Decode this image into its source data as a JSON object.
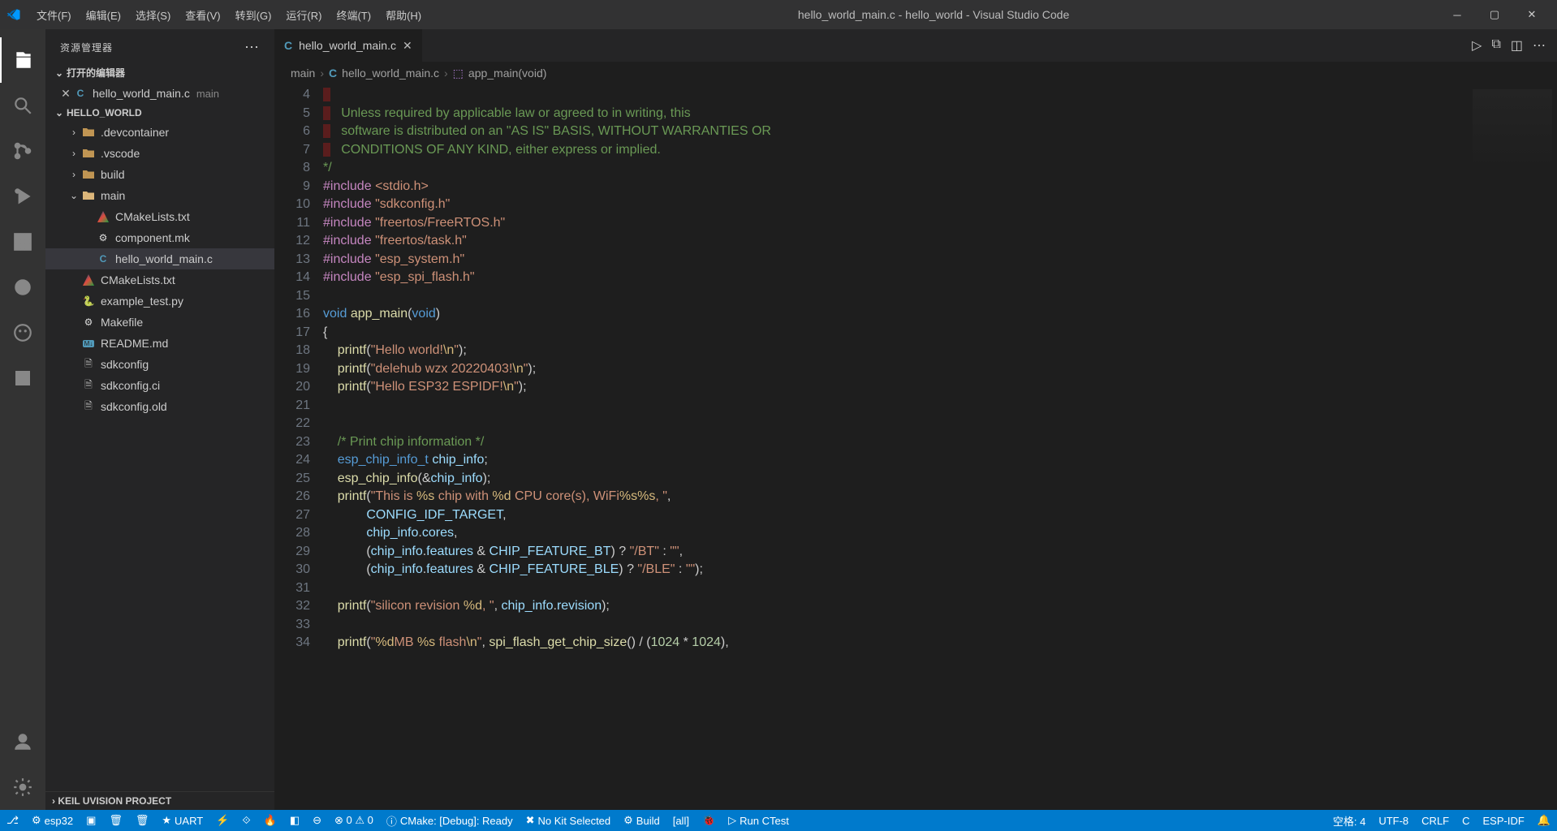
{
  "window": {
    "title": "hello_world_main.c - hello_world - Visual Studio Code",
    "menu": [
      "文件(F)",
      "编辑(E)",
      "选择(S)",
      "查看(V)",
      "转到(G)",
      "运行(R)",
      "终端(T)",
      "帮助(H)"
    ]
  },
  "sidebar": {
    "header": "资源管理器",
    "open_editors_label": "打开的编辑器",
    "open_editor_file": "hello_world_main.c",
    "open_editor_folder": "main",
    "project_label": "HELLO_WORLD",
    "bottom_panel": "KEIL UVISION PROJECT",
    "tree": [
      {
        "type": "folder",
        "label": ".devcontainer",
        "depth": 1
      },
      {
        "type": "folder",
        "label": ".vscode",
        "depth": 1
      },
      {
        "type": "folder",
        "label": "build",
        "depth": 1
      },
      {
        "type": "folder",
        "label": "main",
        "depth": 1,
        "open": true
      },
      {
        "type": "cmake",
        "label": "CMakeLists.txt",
        "depth": 2
      },
      {
        "type": "gear",
        "label": "component.mk",
        "depth": 2
      },
      {
        "type": "c",
        "label": "hello_world_main.c",
        "depth": 2,
        "selected": true
      },
      {
        "type": "cmake",
        "label": "CMakeLists.txt",
        "depth": 1
      },
      {
        "type": "py",
        "label": "example_test.py",
        "depth": 1
      },
      {
        "type": "gear",
        "label": "Makefile",
        "depth": 1
      },
      {
        "type": "md",
        "label": "README.md",
        "depth": 1
      },
      {
        "type": "file",
        "label": "sdkconfig",
        "depth": 1
      },
      {
        "type": "file",
        "label": "sdkconfig.ci",
        "depth": 1
      },
      {
        "type": "file",
        "label": "sdkconfig.old",
        "depth": 1
      }
    ]
  },
  "tab": {
    "label": "hello_world_main.c"
  },
  "breadcrumbs": {
    "root": "main",
    "file": "hello_world_main.c",
    "symbol": "app_main(void)"
  },
  "code_lines": [
    {
      "n": 4,
      "html": "",
      "red": true
    },
    {
      "n": 5,
      "html": "   Unless required by applicable law or agreed to in writing, this",
      "cmt": true,
      "red": true
    },
    {
      "n": 6,
      "html": "   software is distributed on an \"AS IS\" BASIS, WITHOUT WARRANTIES OR",
      "cmt": true,
      "red": true
    },
    {
      "n": 7,
      "html": "   CONDITIONS OF ANY KIND, either express or implied.",
      "cmt": true,
      "red": true
    },
    {
      "n": 8,
      "html": "*/",
      "cmt": true
    },
    {
      "n": 9,
      "html": "<span class='tok-kw'>#include</span> <span class='tok-str'>&lt;stdio.h&gt;</span>"
    },
    {
      "n": 10,
      "html": "<span class='tok-kw'>#include</span> <span class='tok-str'>\"sdkconfig.h\"</span>"
    },
    {
      "n": 11,
      "html": "<span class='tok-kw'>#include</span> <span class='tok-str'>\"freertos/FreeRTOS.h\"</span>"
    },
    {
      "n": 12,
      "html": "<span class='tok-kw'>#include</span> <span class='tok-str'>\"freertos/task.h\"</span>"
    },
    {
      "n": 13,
      "html": "<span class='tok-kw'>#include</span> <span class='tok-str'>\"esp_system.h\"</span>"
    },
    {
      "n": 14,
      "html": "<span class='tok-kw'>#include</span> <span class='tok-str'>\"esp_spi_flash.h\"</span>"
    },
    {
      "n": 15,
      "html": ""
    },
    {
      "n": 16,
      "html": "<span class='tok-type'>void</span> <span class='tok-fn'>app_main</span>(<span class='tok-type'>void</span>)"
    },
    {
      "n": 17,
      "html": "{"
    },
    {
      "n": 18,
      "html": "    <span class='tok-fn'>printf</span>(<span class='tok-str'>\"Hello world!<span class='tok-esc'>\\n</span>\"</span>);"
    },
    {
      "n": 19,
      "html": "    <span class='tok-fn'>printf</span>(<span class='tok-str'>\"delehub wzx 20220403!<span class='tok-esc'>\\n</span>\"</span>);"
    },
    {
      "n": 20,
      "html": "    <span class='tok-fn'>printf</span>(<span class='tok-str'>\"Hello ESP32 ESPIDF!<span class='tok-esc'>\\n</span>\"</span>);"
    },
    {
      "n": 21,
      "html": ""
    },
    {
      "n": 22,
      "html": ""
    },
    {
      "n": 23,
      "html": "    <span class='tok-cmt'>/* Print chip information */</span>"
    },
    {
      "n": 24,
      "html": "    <span class='tok-type'>esp_chip_info_t</span> <span class='tok-var'>chip_info</span>;"
    },
    {
      "n": 25,
      "html": "    <span class='tok-fn'>esp_chip_info</span>(&amp;<span class='tok-var'>chip_info</span>);"
    },
    {
      "n": 26,
      "html": "    <span class='tok-fn'>printf</span>(<span class='tok-str'>\"This is <span class='tok-esc'>%s</span> chip with <span class='tok-esc'>%d</span> CPU core(s), WiFi<span class='tok-esc'>%s%s</span>, \"</span>,"
    },
    {
      "n": 27,
      "html": "            <span class='tok-var'>CONFIG_IDF_TARGET</span>,"
    },
    {
      "n": 28,
      "html": "            <span class='tok-var'>chip_info</span>.<span class='tok-var'>cores</span>,"
    },
    {
      "n": 29,
      "html": "            (<span class='tok-var'>chip_info</span>.<span class='tok-var'>features</span> &amp; <span class='tok-var'>CHIP_FEATURE_BT</span>) ? <span class='tok-str'>\"/BT\"</span> : <span class='tok-str'>\"\"</span>,"
    },
    {
      "n": 30,
      "html": "            (<span class='tok-var'>chip_info</span>.<span class='tok-var'>features</span> &amp; <span class='tok-var'>CHIP_FEATURE_BLE</span>) ? <span class='tok-str'>\"/BLE\"</span> : <span class='tok-str'>\"\"</span>);"
    },
    {
      "n": 31,
      "html": ""
    },
    {
      "n": 32,
      "html": "    <span class='tok-fn'>printf</span>(<span class='tok-str'>\"silicon revision <span class='tok-esc'>%d</span>, \"</span>, <span class='tok-var'>chip_info</span>.<span class='tok-var'>revision</span>);"
    },
    {
      "n": 33,
      "html": ""
    },
    {
      "n": 34,
      "html": "    <span class='tok-fn'>printf</span>(<span class='tok-str'>\"<span class='tok-esc'>%d</span>MB <span class='tok-esc'>%s</span> flash<span class='tok-esc'>\\n</span>\"</span>, <span class='tok-fn'>spi_flash_get_chip_size</span>() / (<span class='tok-num'>1024</span> * <span class='tok-num'>1024</span>),"
    }
  ],
  "statusbar": {
    "left": [
      {
        "icon": "⎇",
        "label": ""
      },
      {
        "icon": "⚙",
        "label": "esp32"
      },
      {
        "icon": "▣",
        "label": ""
      },
      {
        "icon": "🗑",
        "label": ""
      },
      {
        "icon": "🗑",
        "label": ""
      },
      {
        "icon": "★",
        "label": "UART"
      },
      {
        "icon": "⚡",
        "label": ""
      },
      {
        "icon": "⟐",
        "label": ""
      },
      {
        "icon": "🔥",
        "label": ""
      },
      {
        "icon": "◧",
        "label": ""
      },
      {
        "icon": "⊖",
        "label": ""
      },
      {
        "icon": "",
        "label": "⊗ 0 ⚠ 0"
      },
      {
        "icon": "ⓘ",
        "label": "CMake: [Debug]: Ready"
      },
      {
        "icon": "✖",
        "label": "No Kit Selected"
      },
      {
        "icon": "⚙",
        "label": "Build"
      },
      {
        "icon": "",
        "label": "[all]"
      },
      {
        "icon": "🐞",
        "label": ""
      },
      {
        "icon": "▷",
        "label": "Run CTest"
      }
    ],
    "right": [
      {
        "label": "空格: 4"
      },
      {
        "label": "UTF-8"
      },
      {
        "label": "CRLF"
      },
      {
        "label": "C"
      },
      {
        "label": "ESP-IDF"
      },
      {
        "label": "🔔"
      }
    ]
  }
}
